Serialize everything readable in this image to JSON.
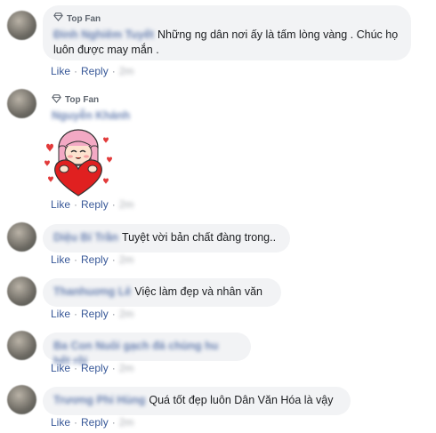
{
  "top_fan_label": "Top Fan",
  "actions": {
    "like": "Like",
    "reply": "Reply",
    "separator": "·",
    "time": "2m"
  },
  "comments": [
    {
      "name": "Đinh Nghiêm Tuyết",
      "top_fan": true,
      "text": "Những ng dân nơi ấy là tấm lòng vàng . Chúc họ luôn được may mắn ."
    },
    {
      "name": "Nguyễn Khánh",
      "top_fan": true,
      "sticker": "girl-hugging-heart-sticker"
    },
    {
      "name": "Diệu Bí Trần",
      "text": "Tuyệt vời bản chất đàng trong.."
    },
    {
      "name": "Thanhuơng Lê",
      "text": "Việc làm đẹp và nhân văn"
    },
    {
      "name": "Ba Con Nuôi gạch đá chùng hu hết rồi",
      "text": ""
    },
    {
      "name": "Trương Phi Hùng",
      "text": "Quá tốt đẹp luôn Dân Văn Hóa là vậy"
    }
  ],
  "colors": {
    "link": "#385898",
    "bubble": "#f2f3f5",
    "meta": "#90949c"
  }
}
